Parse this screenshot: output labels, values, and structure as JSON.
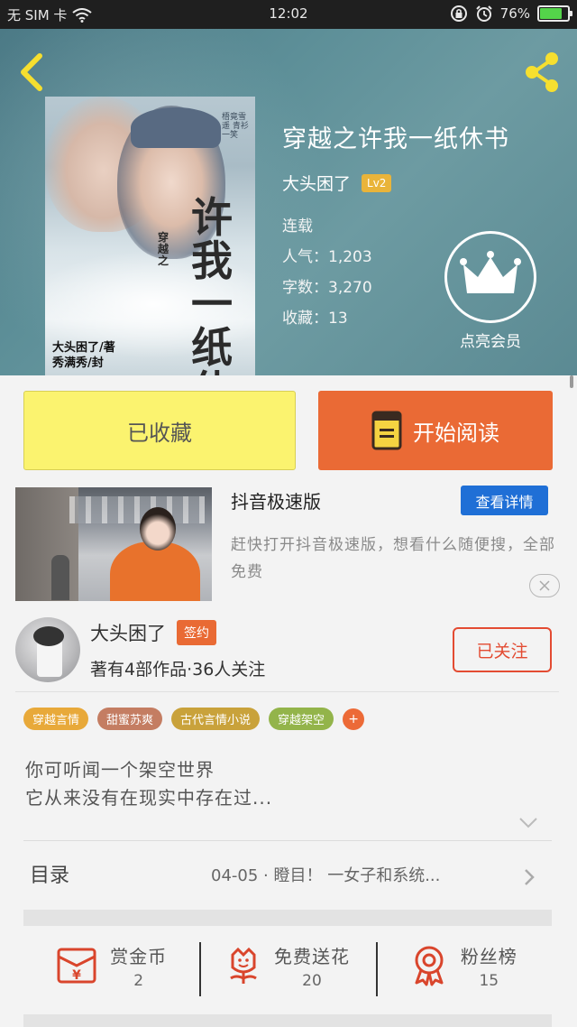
{
  "status_bar": {
    "carrier": "无 SIM 卡",
    "time": "12:02",
    "battery": "76%",
    "battery_level": 0.76
  },
  "book": {
    "title": "穿越之许我一纸休书",
    "author": "大头困了",
    "author_level": "Lv2",
    "status": "连载",
    "popularity_label": "人气：",
    "popularity": "1,203",
    "word_count_label": "字数：",
    "word_count": "3,270",
    "favorites_label": "收藏：",
    "favorites": "13",
    "vip_label": "点亮会员",
    "cover": {
      "title_vertical": "许我一纸休书",
      "prefix_vertical": "穿越之",
      "poem": "梧竟雪遥 青衫一笑",
      "credit_author": "大头困了/著",
      "credit_cover": "秀满秀/封"
    }
  },
  "actions": {
    "collected": "已收藏",
    "start_reading": "开始阅读"
  },
  "ad": {
    "title": "抖音极速版",
    "detail_button": "查看详情",
    "description": "赶快打开抖音极速版，想看什么随便搜，全部免费"
  },
  "author_block": {
    "name": "大头困了",
    "badge": "签约",
    "stats": "著有4部作品·36人关注",
    "follow_button": "已关注"
  },
  "tags": [
    {
      "label": "穿越言情",
      "color": "#e8a93a"
    },
    {
      "label": "甜蜜苏爽",
      "color": "#c47d62"
    },
    {
      "label": "古代言情小说",
      "color": "#c9a23b"
    },
    {
      "label": "穿越架空",
      "color": "#93b44a"
    }
  ],
  "tag_more": "+",
  "intro": {
    "line1": "你可听闻一个架空世界",
    "line2": "它从来没有在现实中存在过..."
  },
  "toc": {
    "label": "目录",
    "latest": "04-05 · 瞪目！ 一女子和系统..."
  },
  "rewards": [
    {
      "label": "赏金币",
      "value": "2"
    },
    {
      "label": "免费送花",
      "value": "20"
    },
    {
      "label": "粉丝榜",
      "value": "15"
    }
  ],
  "colors": {
    "accent_orange": "#ea6a35",
    "collect_yellow": "#fbf36f",
    "icon_red": "#d9452c",
    "follow_red": "#e34b32",
    "detail_blue": "#1f6fd6"
  }
}
